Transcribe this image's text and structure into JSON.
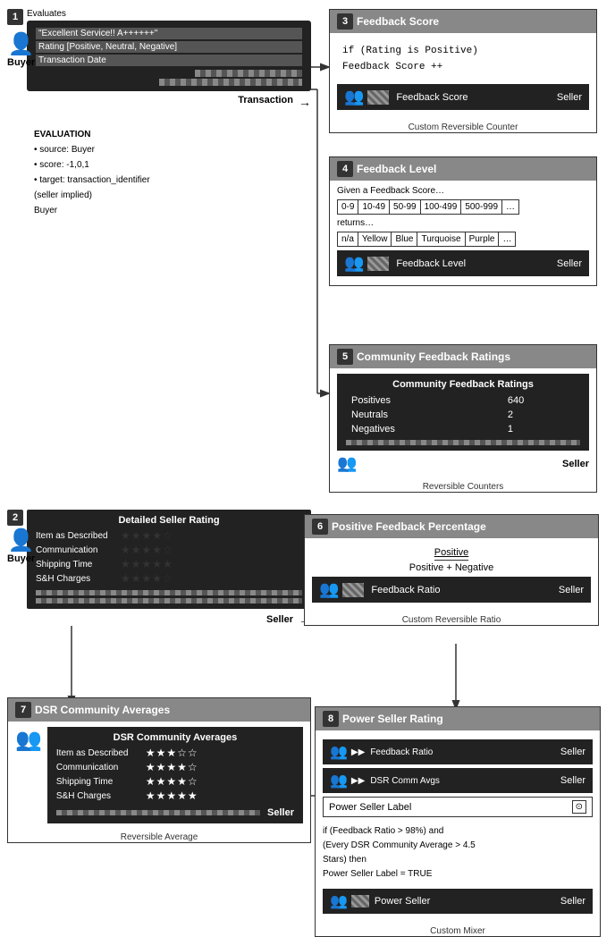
{
  "sections": {
    "s1": {
      "number": "1",
      "buyer_label": "Buyer",
      "transaction_label": "Transaction",
      "evaluates_label": "Evaluates",
      "transaction_items": [
        "\"Excellent Service!! A++++++\"",
        "Rating [Positive, Neutral, Negative]",
        "Transaction Date"
      ]
    },
    "s2": {
      "number": "2",
      "buyer_label": "Buyer",
      "seller_label": "Seller",
      "header": "Detailed Seller Rating",
      "items": [
        {
          "label": "Item as Described",
          "stars": "★★★★☆"
        },
        {
          "label": "Communication",
          "stars": "★★★★☆"
        },
        {
          "label": "Shipping Time",
          "stars": "★★★★★"
        },
        {
          "label": "S&H Charges",
          "stars": "★★★★☆"
        }
      ]
    },
    "s3": {
      "number": "3",
      "header": "Feedback Score",
      "code_line1": "if (Rating is Positive)",
      "code_line2": "    Feedback Score ++",
      "store_label": "Feedback Score",
      "seller_label": "Seller",
      "caption": "Custom Reversible Counter"
    },
    "s4": {
      "number": "4",
      "header": "Feedback Level",
      "given_label": "Given a Feedback Score…",
      "ranges": [
        "0-9",
        "10-49",
        "50-99",
        "100-499",
        "500-999",
        "…"
      ],
      "returns_label": "returns…",
      "levels": [
        "n/a",
        "Yellow",
        "Blue",
        "Turquoise",
        "Purple",
        "…"
      ],
      "store_label": "Feedback Level",
      "seller_label": "Seller"
    },
    "s5": {
      "number": "5",
      "header": "Community Feedback Ratings",
      "table_header": "Community Feedback Ratings",
      "rows": [
        {
          "label": "Positives",
          "value": "640"
        },
        {
          "label": "Neutrals",
          "value": "2"
        },
        {
          "label": "Negatives",
          "value": "1"
        }
      ],
      "seller_label": "Seller",
      "caption": "Reversible Counters"
    },
    "s6": {
      "number": "6",
      "header": "Positive Feedback Percentage",
      "numerator": "Positive",
      "denominator": "Positive + Negative",
      "store_label": "Feedback Ratio",
      "seller_label": "Seller",
      "caption": "Custom Reversible Ratio"
    },
    "s7": {
      "number": "7",
      "header": "DSR Community Averages",
      "table_header": "DSR Community Averages",
      "items": [
        {
          "label": "Item as Described",
          "stars": "★★★☆☆"
        },
        {
          "label": "Communication",
          "stars": "★★★★☆"
        },
        {
          "label": "Shipping Time",
          "stars": "★★★★☆"
        },
        {
          "label": "S&H Charges",
          "stars": "★★★★★"
        }
      ],
      "seller_label": "Seller",
      "caption": "Reversible Average"
    },
    "s8": {
      "number": "8",
      "header": "Power Seller Rating",
      "store1_label": "Feedback Ratio",
      "store2_label": "DSR Comm Avgs",
      "seller_label": "Seller",
      "power_seller_label": "Power Seller Label",
      "code_line1": "if (Feedback Ratio > 98%) and",
      "code_line2": "(Every DSR Community Average > 4.5",
      "code_line3": "Stars) then",
      "code_line4": "    Power Seller Label = TRUE",
      "store3_label": "Power Seller",
      "caption": "Custom Mixer"
    },
    "evaluation": {
      "title": "EVALUATION",
      "line1": "• source: Buyer",
      "line2": "• score: -1,0,1",
      "line3": "• target: transaction_identifier",
      "line4": "(seller implied)",
      "line5": "Buyer"
    }
  }
}
